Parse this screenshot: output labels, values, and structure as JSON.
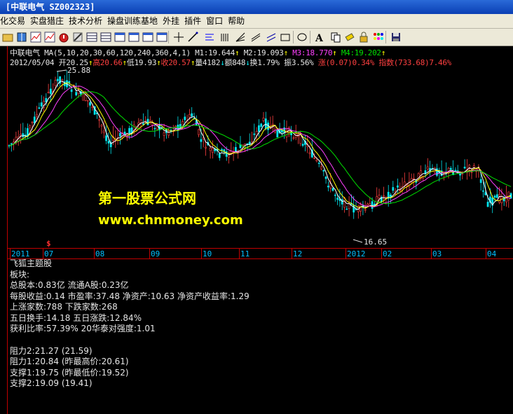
{
  "window": {
    "title_text": "[中联电气  SZ002323]"
  },
  "menu": [
    "化交易",
    "实盘猎庄",
    "技术分析",
    "操盘训练基地",
    "外挂",
    "插件",
    "窗口",
    "帮助"
  ],
  "toolbar": {
    "icons": [
      "open-icon",
      "book-icon",
      "chart-icon",
      "chart-icon",
      "alarm-icon",
      "edit-icon",
      "grid-icon",
      "grid-icon",
      "window-icon",
      "window-icon",
      "window-icon",
      "window-icon",
      "cross-cursor-icon",
      "line-icon",
      "text-align-icon",
      "bars-icon",
      "fan-icon",
      "parallel-lines-icon",
      "channel-icon",
      "rectangle-icon",
      "ellipse-icon",
      "text-tool-icon",
      "copy-icon",
      "eraser-icon",
      "lock-icon",
      "palette-icon",
      "save-icon"
    ]
  },
  "header": {
    "stock_name": "中联电气",
    "ma_label": "MA(5,10,20,30,60,120,240,360,4,1)",
    "m1": "M1:19.644",
    "m2": "M2:19.093",
    "m3": "M3:18.770",
    "m4": "M4:19.202",
    "date": "2012/05/04",
    "open": "开20.25",
    "high": "高20.66",
    "low": "低19.93",
    "close": "收20.57",
    "volume": "量4182",
    "amount": "额848",
    "turnover": "换1.79%",
    "amplitude": "振3.56%",
    "change": "涨(0.07)0.34%",
    "index": "指数(733.68)7.46%"
  },
  "chart_labels": {
    "high_mark": "25.88",
    "low_mark": "16.65",
    "marker": "$",
    "watermark_cn": "第一股票公式网",
    "watermark_url": "www.chnmoney.com"
  },
  "date_axis": [
    "2011",
    "07",
    "08",
    "09",
    "10",
    "11",
    "12",
    "2012",
    "02",
    "03",
    "04"
  ],
  "info": {
    "block_title": "飞狐主题股",
    "sector": "板块:",
    "capital": "总股本:0.83亿 流通A股:0.23亿",
    "eps": "每股收益:0.14 市盈率:37.48 净资产:10.63 净资产收益率:1.29",
    "updown": "上涨家数:788 下跌家数:268",
    "five_day": "五日换手:14.18 五日涨跌:12.84%",
    "profit": "获利比率:57.39% 20华泰对强度:1.01",
    "resist2": "阻力2:21.27 (21.59)",
    "resist1": "阻力1:20.84 (昨最高价:20.61)",
    "support1": "支撑1:19.75 (昨最低价:19.52)",
    "support2": "支撑2:19.09 (19.41)"
  },
  "colors": {
    "up": "#ff4040",
    "down": "#00e5ee",
    "ma1": "#ffffff",
    "ma2": "#ffff00",
    "ma3": "#ff40ff",
    "ma4": "#00e000",
    "axis": "#c00000"
  }
}
